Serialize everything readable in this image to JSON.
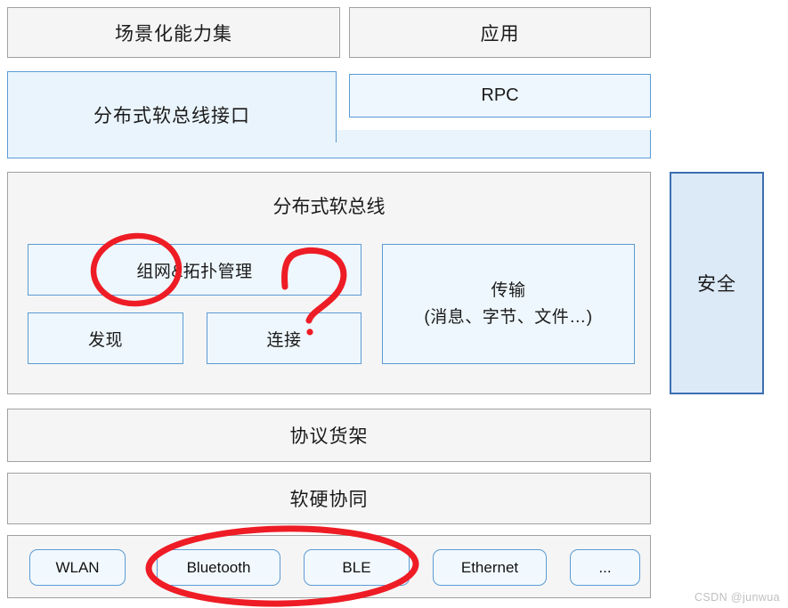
{
  "diagram": {
    "title_watermark": "CSDN @junwua",
    "top_row": {
      "capability_set": "场景化能力集",
      "application": "应用"
    },
    "interface_row": {
      "softbus_interface": "分布式软总线接口",
      "rpc": "RPC"
    },
    "softbus_panel": {
      "title": "分布式软总线",
      "networking_topology": "组网&拓扑管理",
      "discovery": "发现",
      "connection": "连接",
      "transmission_line1": "传输",
      "transmission_line2": "(消息、字节、文件…)"
    },
    "security_column": {
      "label": "安全"
    },
    "protocol_shelf": {
      "label": "协议货架"
    },
    "hw_sw_coordination": {
      "label": "软硬协同"
    },
    "protocol_chips": [
      {
        "label": "WLAN"
      },
      {
        "label": "Bluetooth"
      },
      {
        "label": "BLE"
      },
      {
        "label": "Ethernet"
      },
      {
        "label": "..."
      }
    ],
    "annotations": {
      "ellipse_networking": "red-ellipse-around-networking-topology",
      "question_mark": "red-handdrawn-question-mark",
      "ellipse_bluetooth_ble": "red-ellipse-around-bluetooth-and-ble",
      "ink_color": "#ee1c25"
    }
  }
}
